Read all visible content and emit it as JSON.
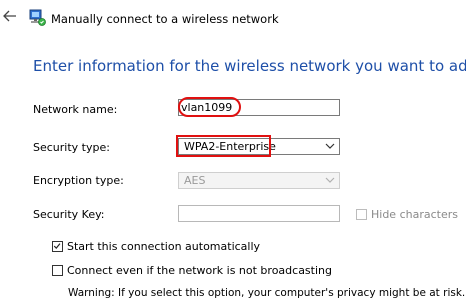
{
  "window": {
    "title": "Manually connect to a wireless network"
  },
  "heading": "Enter information for the wireless network you want to add",
  "form": {
    "network_name": {
      "label": "Network name:",
      "value": "vlan1099"
    },
    "security_type": {
      "label": "Security type:",
      "value": "WPA2-Enterprise"
    },
    "encryption_type": {
      "label": "Encryption type:",
      "value": "AES"
    },
    "security_key": {
      "label": "Security Key:",
      "value": "",
      "hide_characters_label": "Hide characters",
      "hide_characters_checked": false
    }
  },
  "options": {
    "start_auto": {
      "label": "Start this connection automatically",
      "checked": true
    },
    "connect_even": {
      "label": "Connect even if the network is not broadcasting",
      "checked": false
    }
  },
  "warning": "Warning: If you select this option, your computer's privacy might be at risk.",
  "icons": {
    "back": "back-arrow-icon",
    "app": "network-icon",
    "dropdown": "chevron-down-icon",
    "check": "check-icon"
  },
  "colors": {
    "heading": "#1e4fa8",
    "highlight": "#e01010"
  }
}
